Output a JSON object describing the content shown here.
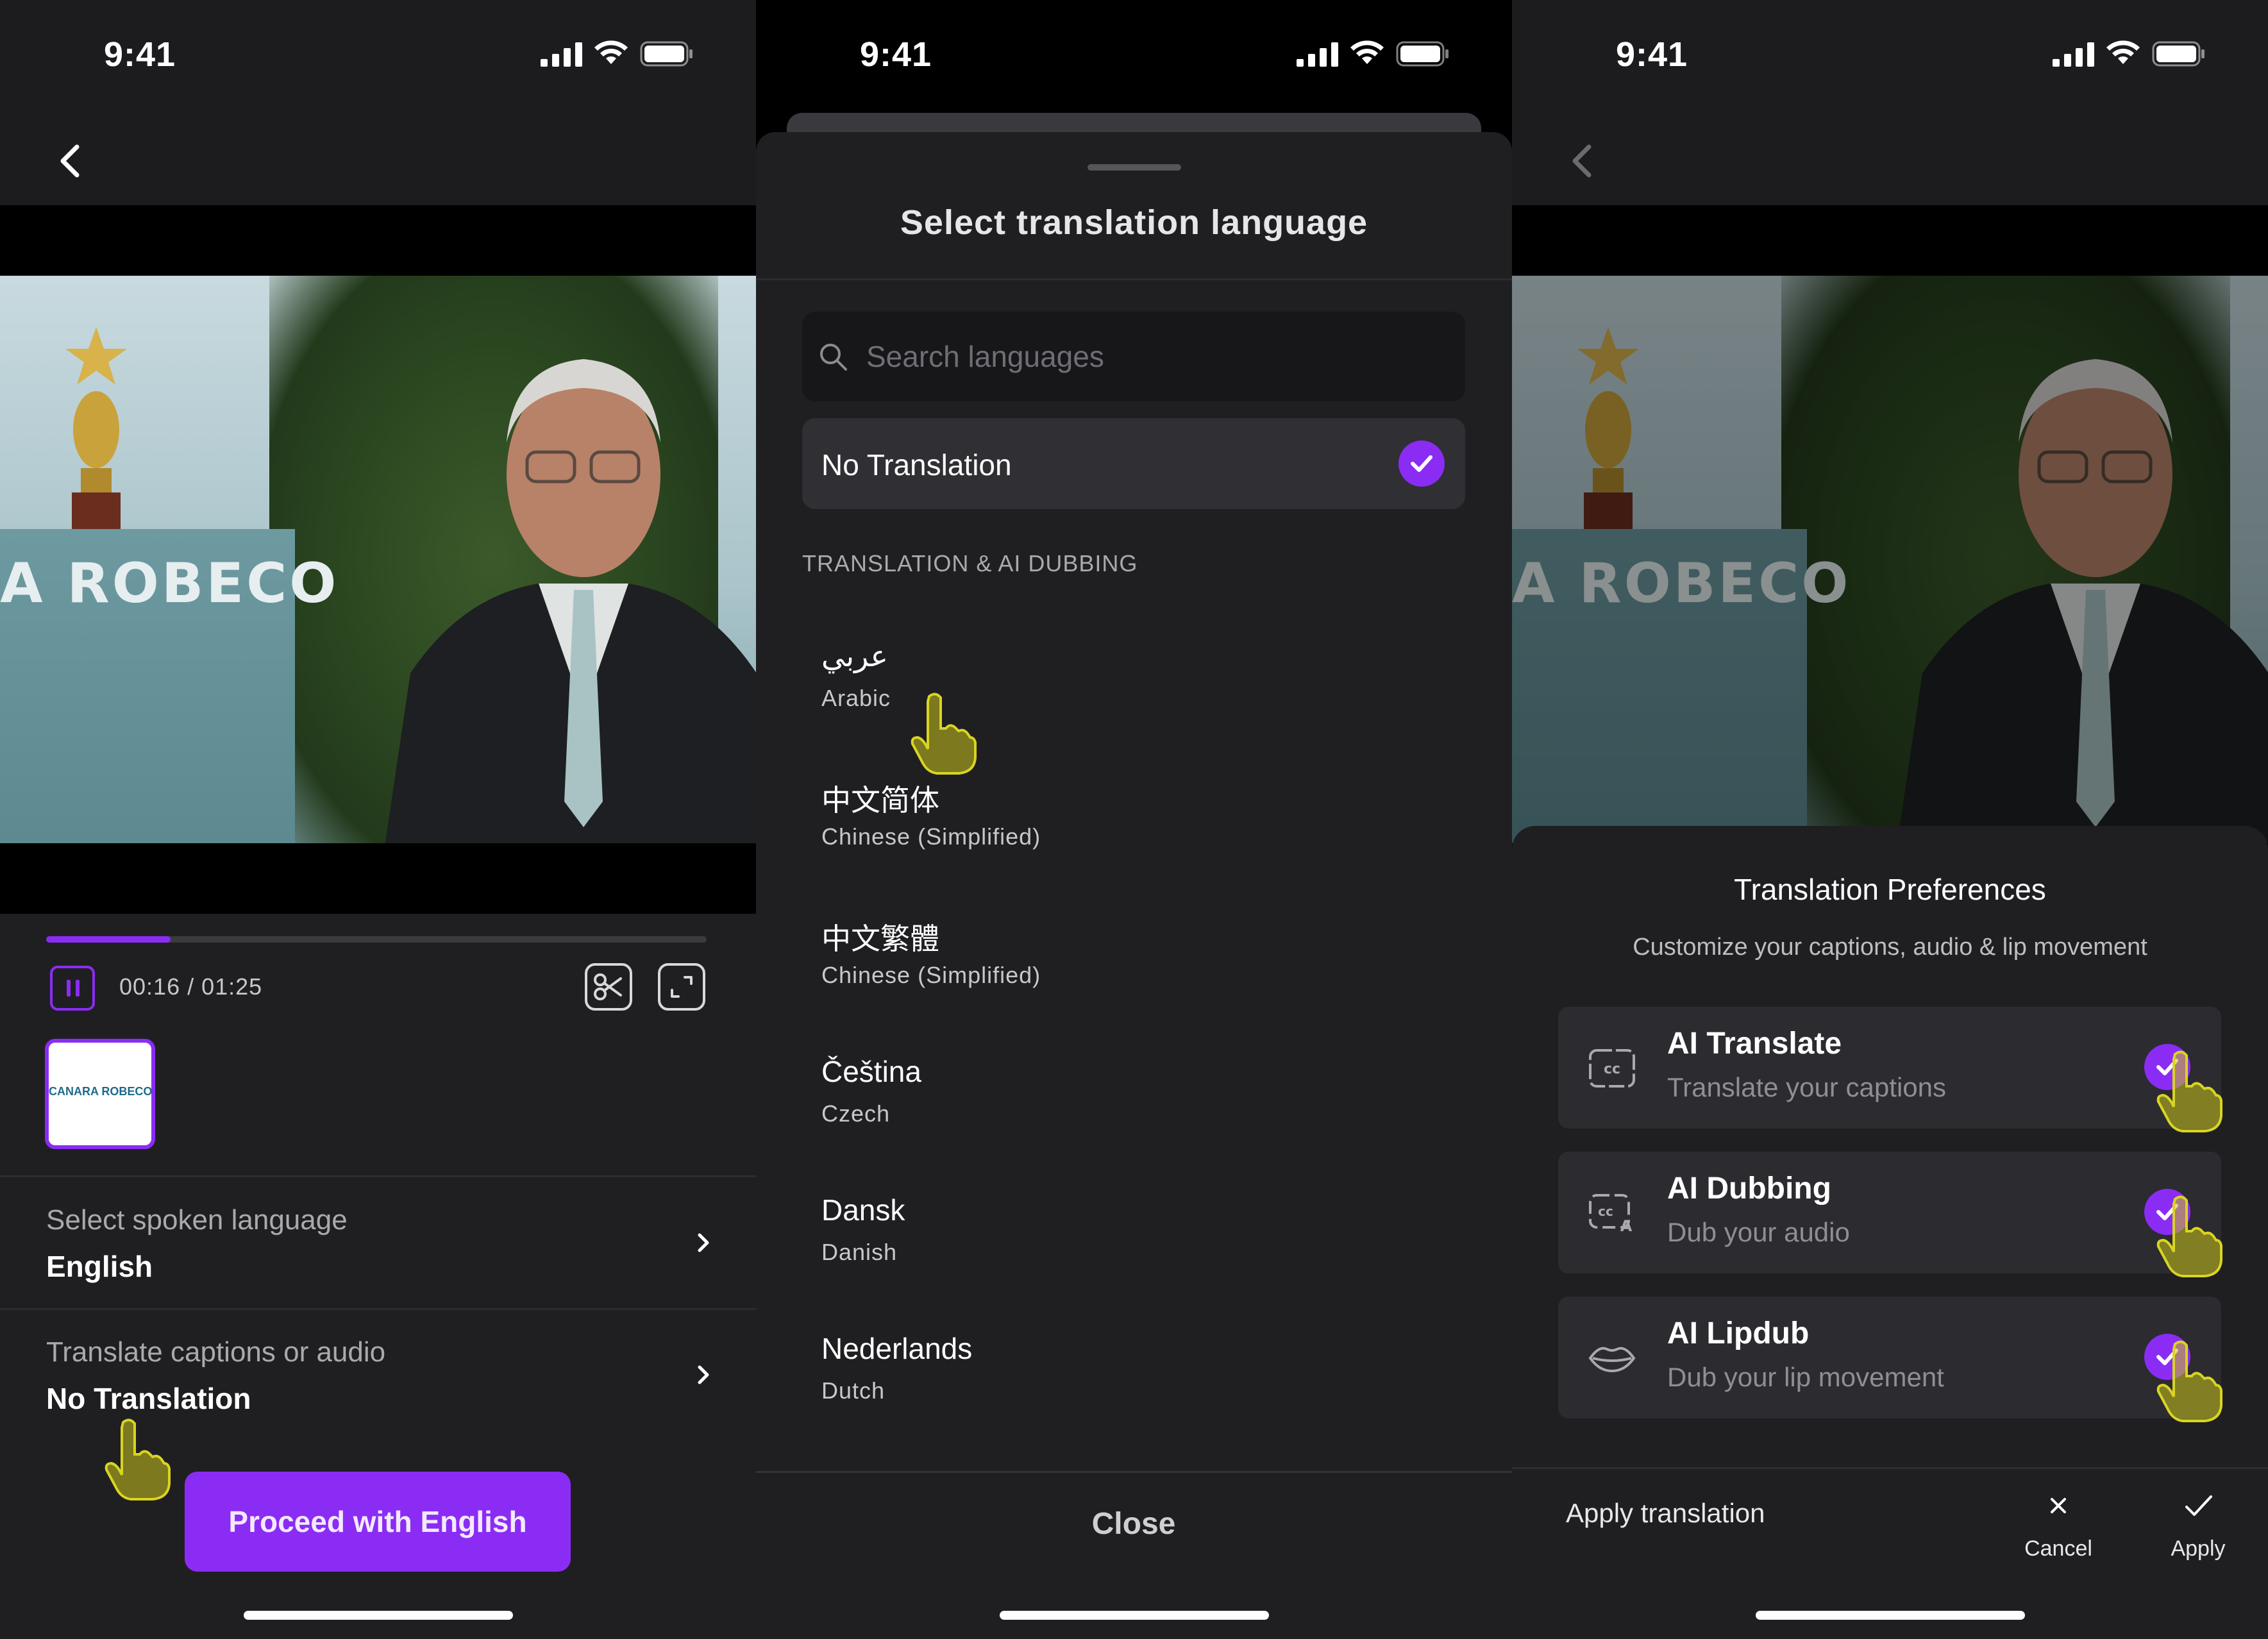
{
  "status_time": "9:41",
  "colors": {
    "accent": "#8b2cf5",
    "background": "#1f1f22",
    "hand": "#c9c31c"
  },
  "screen1": {
    "brand_text": "A ROBECO",
    "timecode": "00:16 / 01:25",
    "progress_fraction": 0.188,
    "thumb_text": "CANARA ROBECO",
    "spoken_language_label": "Select spoken language",
    "spoken_language_value": "English",
    "translate_label": "Translate captions or audio",
    "translate_value": "No Translation",
    "proceed_button": "Proceed with English"
  },
  "screen2": {
    "title": "Select translation language",
    "search_placeholder": "Search languages",
    "no_translation": "No Translation",
    "section_header": "TRANSLATION & AI DUBBING",
    "languages": [
      {
        "native": "عربي",
        "english": "Arabic"
      },
      {
        "native": "中文简体",
        "english": "Chinese (Simplified)"
      },
      {
        "native": "中文繁體",
        "english": "Chinese (Simplified)"
      },
      {
        "native": "Čeština",
        "english": "Czech"
      },
      {
        "native": "Dansk",
        "english": "Danish"
      },
      {
        "native": "Nederlands",
        "english": "Dutch"
      }
    ],
    "close_button": "Close"
  },
  "screen3": {
    "brand_text": "A ROBECO",
    "title": "Translation Preferences",
    "subtitle": "Customize your captions, audio & lip movement",
    "options": [
      {
        "title": "AI Translate",
        "subtitle": "Translate your captions",
        "icon": "captions-icon",
        "checked": true
      },
      {
        "title": "AI Dubbing",
        "subtitle": "Dub your audio",
        "icon": "dubbing-icon",
        "checked": true
      },
      {
        "title": "AI Lipdub",
        "subtitle": "Dub your lip movement",
        "icon": "lips-icon",
        "checked": true
      }
    ],
    "apply_translation_label": "Apply translation",
    "cancel_label": "Cancel",
    "apply_label": "Apply"
  }
}
